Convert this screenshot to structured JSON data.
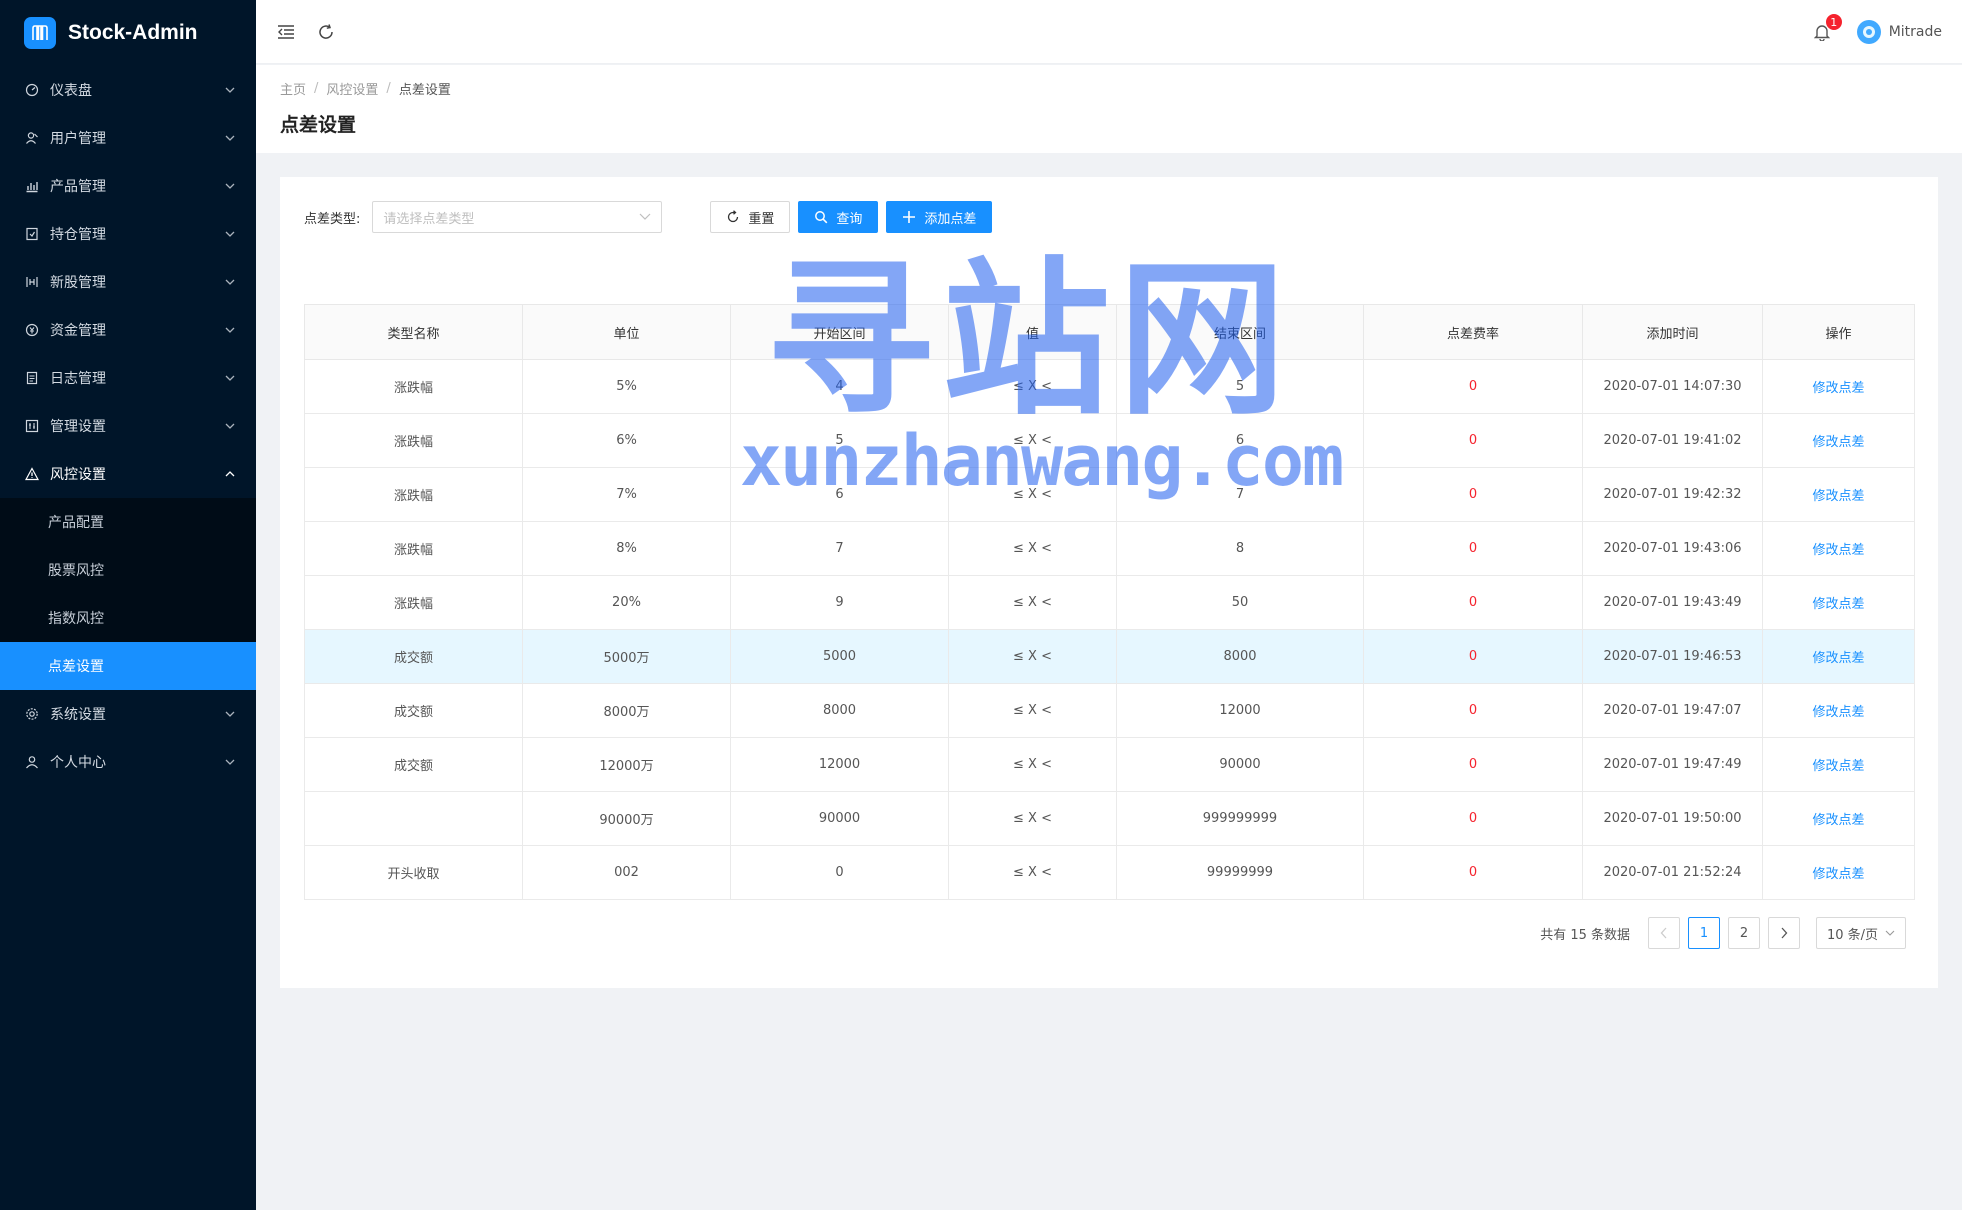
{
  "app": {
    "title": "Stock-Admin"
  },
  "sidebar": {
    "items": [
      {
        "label": "仪表盘",
        "icon": "dashboard-icon"
      },
      {
        "label": "用户管理",
        "icon": "user-manage-icon"
      },
      {
        "label": "产品管理",
        "icon": "chart-icon"
      },
      {
        "label": "持仓管理",
        "icon": "position-icon"
      },
      {
        "label": "新股管理",
        "icon": "new-stock-icon"
      },
      {
        "label": "资金管理",
        "icon": "money-icon"
      },
      {
        "label": "日志管理",
        "icon": "log-icon"
      },
      {
        "label": "管理设置",
        "icon": "admin-settings-icon"
      },
      {
        "label": "风控设置",
        "icon": "warning-icon"
      }
    ],
    "risk_sub": [
      {
        "label": "产品配置"
      },
      {
        "label": "股票风控"
      },
      {
        "label": "指数风控"
      },
      {
        "label": "点差设置"
      }
    ],
    "bottom_items": [
      {
        "label": "系统设置",
        "icon": "gear-icon"
      },
      {
        "label": "个人中心",
        "icon": "person-icon"
      }
    ]
  },
  "header": {
    "notification_count": "1",
    "username": "Mitrade"
  },
  "breadcrumb": [
    "主页",
    "风控设置",
    "点差设置"
  ],
  "page_title": "点差设置",
  "filters": {
    "type_label": "点差类型:",
    "type_placeholder": "请选择点差类型",
    "reset_label": "重置",
    "search_label": "查询",
    "add_label": "添加点差"
  },
  "table": {
    "columns": [
      "类型名称",
      "单位",
      "开始区间",
      "值",
      "结束区间",
      "点差费率",
      "添加时间",
      "操作"
    ],
    "action_label": "修改点差",
    "rows": [
      {
        "name": "涨跌幅",
        "unit": "5%",
        "start": "4",
        "op": "≤ X <",
        "end": "5",
        "rate": "0",
        "time": "2020-07-01 14:07:30"
      },
      {
        "name": "涨跌幅",
        "unit": "6%",
        "start": "5",
        "op": "≤ X <",
        "end": "6",
        "rate": "0",
        "time": "2020-07-01 19:41:02"
      },
      {
        "name": "涨跌幅",
        "unit": "7%",
        "start": "6",
        "op": "≤ X <",
        "end": "7",
        "rate": "0",
        "time": "2020-07-01 19:42:32"
      },
      {
        "name": "涨跌幅",
        "unit": "8%",
        "start": "7",
        "op": "≤ X <",
        "end": "8",
        "rate": "0",
        "time": "2020-07-01 19:43:06"
      },
      {
        "name": "涨跌幅",
        "unit": "20%",
        "start": "9",
        "op": "≤ X <",
        "end": "50",
        "rate": "0",
        "time": "2020-07-01 19:43:49"
      },
      {
        "name": "成交额",
        "unit": "5000万",
        "start": "5000",
        "op": "≤ X <",
        "end": "8000",
        "rate": "0",
        "time": "2020-07-01 19:46:53",
        "highlight": true
      },
      {
        "name": "成交额",
        "unit": "8000万",
        "start": "8000",
        "op": "≤ X <",
        "end": "12000",
        "rate": "0",
        "time": "2020-07-01 19:47:07"
      },
      {
        "name": "成交额",
        "unit": "12000万",
        "start": "12000",
        "op": "≤ X <",
        "end": "90000",
        "rate": "0",
        "time": "2020-07-01 19:47:49"
      },
      {
        "name": "",
        "unit": "90000万",
        "start": "90000",
        "op": "≤ X <",
        "end": "999999999",
        "rate": "0",
        "time": "2020-07-01 19:50:00"
      },
      {
        "name": "开头收取",
        "unit": "002",
        "start": "0",
        "op": "≤ X <",
        "end": "99999999",
        "rate": "0",
        "time": "2020-07-01 21:52:24"
      }
    ]
  },
  "pagination": {
    "total_text": "共有 15 条数据",
    "pages": [
      "1",
      "2"
    ],
    "current": "1",
    "page_size": "10 条/页"
  },
  "watermark": {
    "cn": "寻站网",
    "en": "xunzhanwang.com"
  },
  "colors": {
    "sidebar_bg": "#001529",
    "accent": "#1890ff",
    "danger": "#f5222d"
  }
}
